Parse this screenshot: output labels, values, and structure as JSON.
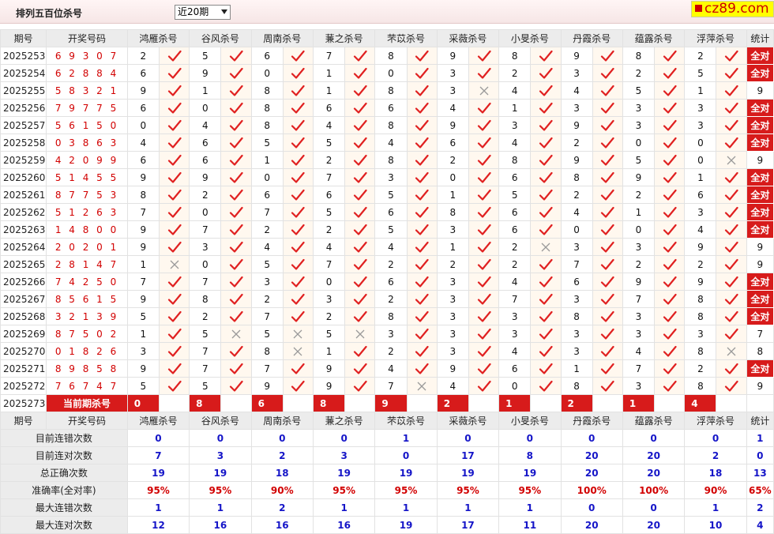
{
  "header": {
    "title": "排列五百位杀号",
    "range_selected": "近20期",
    "site": "cz89.com"
  },
  "columns": {
    "period": "期号",
    "draw": "开奖号码",
    "stat": "统计",
    "experts": [
      "鸿雁杀号",
      "谷风杀号",
      "周南杀号",
      "蒹之杀号",
      "芣苡杀号",
      "采薇杀号",
      "小旻杀号",
      "丹霞杀号",
      "蕴露杀号",
      "浮萍杀号"
    ]
  },
  "rows": [
    {
      "period": "2025253",
      "draw": "6 9 3 0 7",
      "kills": [
        2,
        5,
        6,
        7,
        8,
        9,
        8,
        9,
        8,
        2
      ],
      "hits": [
        1,
        1,
        1,
        1,
        1,
        1,
        1,
        1,
        1,
        1
      ],
      "stat": "全对"
    },
    {
      "period": "2025254",
      "draw": "6 2 8 8 4",
      "kills": [
        6,
        9,
        0,
        1,
        0,
        3,
        2,
        3,
        2,
        5
      ],
      "hits": [
        1,
        1,
        1,
        1,
        1,
        1,
        1,
        1,
        1,
        1
      ],
      "stat": "全对"
    },
    {
      "period": "2025255",
      "draw": "5 8 3 2 1",
      "kills": [
        9,
        1,
        8,
        1,
        8,
        3,
        4,
        4,
        5,
        1
      ],
      "hits": [
        1,
        1,
        1,
        1,
        1,
        0,
        1,
        1,
        1,
        1
      ],
      "stat": "9"
    },
    {
      "period": "2025256",
      "draw": "7 9 7 7 5",
      "kills": [
        6,
        0,
        8,
        6,
        6,
        4,
        1,
        3,
        3,
        3
      ],
      "hits": [
        1,
        1,
        1,
        1,
        1,
        1,
        1,
        1,
        1,
        1
      ],
      "stat": "全对"
    },
    {
      "period": "2025257",
      "draw": "5 6 1 5 0",
      "kills": [
        0,
        4,
        8,
        4,
        8,
        9,
        3,
        9,
        3,
        3
      ],
      "hits": [
        1,
        1,
        1,
        1,
        1,
        1,
        1,
        1,
        1,
        1
      ],
      "stat": "全对"
    },
    {
      "period": "2025258",
      "draw": "0 3 8 6 3",
      "kills": [
        4,
        6,
        5,
        5,
        4,
        6,
        4,
        2,
        0,
        0
      ],
      "hits": [
        1,
        1,
        1,
        1,
        1,
        1,
        1,
        1,
        1,
        1
      ],
      "stat": "全对"
    },
    {
      "period": "2025259",
      "draw": "4 2 0 9 9",
      "kills": [
        6,
        6,
        1,
        2,
        8,
        2,
        8,
        9,
        5,
        0
      ],
      "hits": [
        1,
        1,
        1,
        1,
        1,
        1,
        1,
        1,
        1,
        0
      ],
      "stat": "9"
    },
    {
      "period": "2025260",
      "draw": "5 1 4 5 5",
      "kills": [
        9,
        9,
        0,
        7,
        3,
        0,
        6,
        8,
        9,
        1
      ],
      "hits": [
        1,
        1,
        1,
        1,
        1,
        1,
        1,
        1,
        1,
        1
      ],
      "stat": "全对"
    },
    {
      "period": "2025261",
      "draw": "8 7 7 5 3",
      "kills": [
        8,
        2,
        6,
        6,
        5,
        1,
        5,
        2,
        2,
        6
      ],
      "hits": [
        1,
        1,
        1,
        1,
        1,
        1,
        1,
        1,
        1,
        1
      ],
      "stat": "全对"
    },
    {
      "period": "2025262",
      "draw": "5 1 2 6 3",
      "kills": [
        7,
        0,
        7,
        5,
        6,
        8,
        6,
        4,
        1,
        3
      ],
      "hits": [
        1,
        1,
        1,
        1,
        1,
        1,
        1,
        1,
        1,
        1
      ],
      "stat": "全对"
    },
    {
      "period": "2025263",
      "draw": "1 4 8 0 0",
      "kills": [
        9,
        7,
        2,
        2,
        5,
        3,
        6,
        0,
        0,
        4
      ],
      "hits": [
        1,
        1,
        1,
        1,
        1,
        1,
        1,
        1,
        1,
        1
      ],
      "stat": "全对"
    },
    {
      "period": "2025264",
      "draw": "2 0 2 0 1",
      "kills": [
        9,
        3,
        4,
        4,
        4,
        1,
        2,
        3,
        3,
        9
      ],
      "hits": [
        1,
        1,
        1,
        1,
        1,
        1,
        0,
        1,
        1,
        1
      ],
      "stat": "9"
    },
    {
      "period": "2025265",
      "draw": "2 8 1 4 7",
      "kills": [
        1,
        0,
        5,
        7,
        2,
        2,
        2,
        7,
        2,
        2
      ],
      "hits": [
        0,
        1,
        1,
        1,
        1,
        1,
        1,
        1,
        1,
        1
      ],
      "stat": "9"
    },
    {
      "period": "2025266",
      "draw": "7 4 2 5 0",
      "kills": [
        7,
        7,
        3,
        0,
        6,
        3,
        4,
        6,
        9,
        9
      ],
      "hits": [
        1,
        1,
        1,
        1,
        1,
        1,
        1,
        1,
        1,
        1
      ],
      "stat": "全对"
    },
    {
      "period": "2025267",
      "draw": "8 5 6 1 5",
      "kills": [
        9,
        8,
        2,
        3,
        2,
        3,
        7,
        3,
        7,
        8
      ],
      "hits": [
        1,
        1,
        1,
        1,
        1,
        1,
        1,
        1,
        1,
        1
      ],
      "stat": "全对"
    },
    {
      "period": "2025268",
      "draw": "3 2 1 3 9",
      "kills": [
        5,
        2,
        7,
        2,
        8,
        3,
        3,
        8,
        3,
        8
      ],
      "hits": [
        1,
        1,
        1,
        1,
        1,
        1,
        1,
        1,
        1,
        1
      ],
      "stat": "全对"
    },
    {
      "period": "2025269",
      "draw": "8 7 5 0 2",
      "kills": [
        1,
        5,
        5,
        5,
        3,
        3,
        3,
        3,
        3,
        3
      ],
      "hits": [
        1,
        0,
        0,
        0,
        1,
        1,
        1,
        1,
        1,
        1
      ],
      "stat": "7"
    },
    {
      "period": "2025270",
      "draw": "0 1 8 2 6",
      "kills": [
        3,
        7,
        8,
        1,
        2,
        3,
        4,
        3,
        4,
        8
      ],
      "hits": [
        1,
        1,
        0,
        1,
        1,
        1,
        1,
        1,
        1,
        0
      ],
      "stat": "8"
    },
    {
      "period": "2025271",
      "draw": "8 9 8 5 8",
      "kills": [
        9,
        7,
        7,
        9,
        4,
        9,
        6,
        1,
        7,
        2
      ],
      "hits": [
        1,
        1,
        1,
        1,
        1,
        1,
        1,
        1,
        1,
        1
      ],
      "stat": "全对"
    },
    {
      "period": "2025272",
      "draw": "7 6 7 4 7",
      "kills": [
        5,
        5,
        9,
        9,
        7,
        4,
        0,
        8,
        3,
        8
      ],
      "hits": [
        1,
        1,
        1,
        1,
        0,
        1,
        1,
        1,
        1,
        1
      ],
      "stat": "9"
    }
  ],
  "current": {
    "period": "2025273",
    "label": "当前期杀号",
    "kills": [
      "0",
      "8",
      "6",
      "8",
      "9",
      "2",
      "1",
      "2",
      "1",
      "4"
    ]
  },
  "summary": [
    {
      "label": "目前连错次数",
      "color": "blue",
      "values": [
        "0",
        "0",
        "0",
        "0",
        "1",
        "0",
        "0",
        "0",
        "0",
        "0",
        "1"
      ]
    },
    {
      "label": "目前连对次数",
      "color": "blue",
      "values": [
        "7",
        "3",
        "2",
        "3",
        "0",
        "17",
        "8",
        "20",
        "20",
        "2",
        "0"
      ]
    },
    {
      "label": "总正确次数",
      "color": "blue",
      "values": [
        "19",
        "19",
        "18",
        "19",
        "19",
        "19",
        "19",
        "20",
        "20",
        "18",
        "13"
      ]
    },
    {
      "label": "准确率(全对率)",
      "color": "red",
      "values": [
        "95%",
        "95%",
        "90%",
        "95%",
        "95%",
        "95%",
        "95%",
        "100%",
        "100%",
        "90%",
        "65%"
      ]
    },
    {
      "label": "最大连错次数",
      "color": "blue",
      "values": [
        "1",
        "1",
        "2",
        "1",
        "1",
        "1",
        "1",
        "0",
        "0",
        "1",
        "2"
      ]
    },
    {
      "label": "最大连对次数",
      "color": "blue",
      "values": [
        "12",
        "16",
        "16",
        "16",
        "19",
        "17",
        "11",
        "20",
        "20",
        "10",
        "4"
      ]
    }
  ],
  "colors": {
    "accent_red": "#d71b1b",
    "check_red": "#e02020",
    "cross_grey": "#9a9a9a",
    "summary_blue": "#1515c8"
  }
}
